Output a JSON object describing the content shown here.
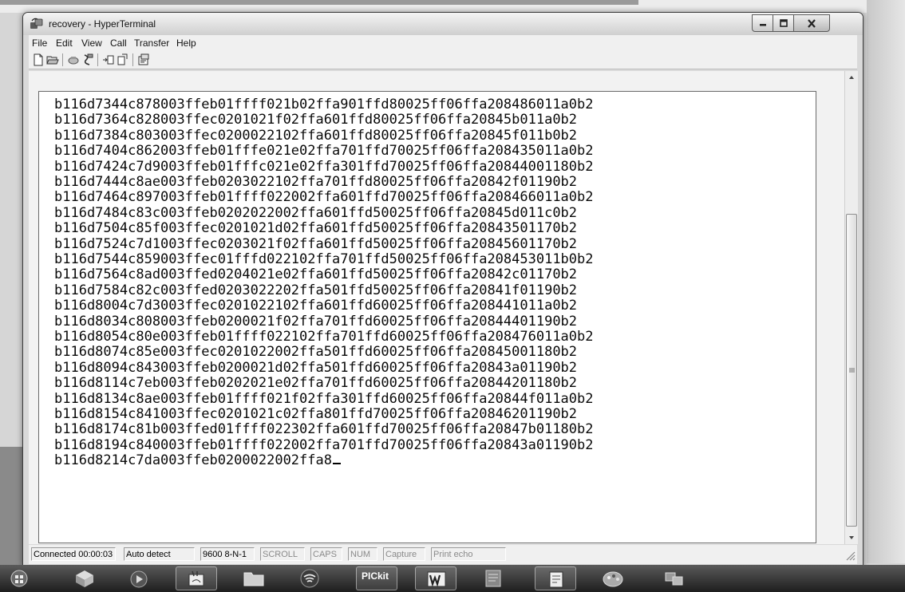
{
  "window": {
    "title": "recovery - HyperTerminal",
    "controls": {
      "minimize": "minimize-icon",
      "maximize": "maximize-icon",
      "close": "close-icon"
    }
  },
  "menu": [
    "File",
    "Edit",
    "View",
    "Call",
    "Transfer",
    "Help"
  ],
  "toolbar": [
    "new-document-icon",
    "open-folder-icon",
    "connect-phone-icon",
    "disconnect-phone-icon",
    "send-file-icon",
    "receive-file-icon",
    "properties-icon"
  ],
  "terminal": {
    "lines": [
      "b116d7344c878003ffeb01ffff021b02ffa901ffd80025ff06ffa208486011a0b2",
      "b116d7364c828003ffec0201021f02ffa601ffd80025ff06ffa20845b011a0b2",
      "b116d7384c803003ffec0200022102ffa601ffd80025ff06ffa20845f011b0b2",
      "b116d7404c862003ffeb01fffe021e02ffa701ffd70025ff06ffa208435011a0b2",
      "b116d7424c7d9003ffeb01fffc021e02ffa301ffd70025ff06ffa20844001180b2",
      "b116d7444c8ae003ffeb0203022102ffa701ffd80025ff06ffa20842f01190b2",
      "b116d7464c897003ffeb01ffff022002ffa601ffd70025ff06ffa208466011a0b2",
      "b116d7484c83c003ffeb0202022002ffa601ffd50025ff06ffa20845d011c0b2",
      "b116d7504c85f003ffec0201021d02ffa601ffd50025ff06ffa20843501170b2",
      "b116d7524c7d1003ffec0203021f02ffa601ffd50025ff06ffa20845601170b2",
      "b116d7544c859003ffec01fffd022102ffa701ffd50025ff06ffa208453011b0b2",
      "b116d7564c8ad003ffed0204021e02ffa601ffd50025ff06ffa20842c01170b2",
      "b116d7584c82c003ffed0203022202ffa501ffd50025ff06ffa20841f01190b2",
      "b116d8004c7d3003ffec0201022102ffa601ffd60025ff06ffa208441011a0b2",
      "b116d8034c808003ffeb0200021f02ffa701ffd60025ff06ffa20844401190b2",
      "b116d8054c80e003ffeb01ffff022102ffa701ffd60025ff06ffa208476011a0b2",
      "b116d8074c85e003ffec0201022002ffa501ffd60025ff06ffa20845001180b2",
      "b116d8094c843003ffeb0200021d02ffa501ffd60025ff06ffa20843a01190b2",
      "b116d8114c7eb003ffeb0202021e02ffa701ffd60025ff06ffa20844201180b2",
      "b116d8134c8ae003ffeb01ffff021f02ffa301ffd60025ff06ffa20844f011a0b2",
      "b116d8154c841003ffec0201021c02ffa801ffd70025ff06ffa20846201190b2",
      "b116d8174c81b003ffed01ffff022302ffa601ffd70025ff06ffa20847b01180b2",
      "b116d8194c840003ffeb01ffff022002ffa701ffd70025ff06ffa20843a01190b2",
      "b116d8214c7da003ffeb0200022002ffa8"
    ]
  },
  "status": {
    "connected": "Connected 00:00:03",
    "detect": "Auto detect",
    "port": "9600 8-N-1",
    "scroll": "SCROLL",
    "caps": "CAPS",
    "num": "NUM",
    "capture": "Capture",
    "print": "Print echo"
  },
  "taskbar": {
    "pickit_label": "PICkit",
    "items": [
      "start-orb-icon",
      "app-cube-icon",
      "media-player-icon",
      "paint-app-icon",
      "folder-icon",
      "wifi-app-icon",
      "pickit-icon",
      "word-icon",
      "document-icon",
      "notepad-icon",
      "paint-palette-icon",
      "network-icon"
    ]
  }
}
